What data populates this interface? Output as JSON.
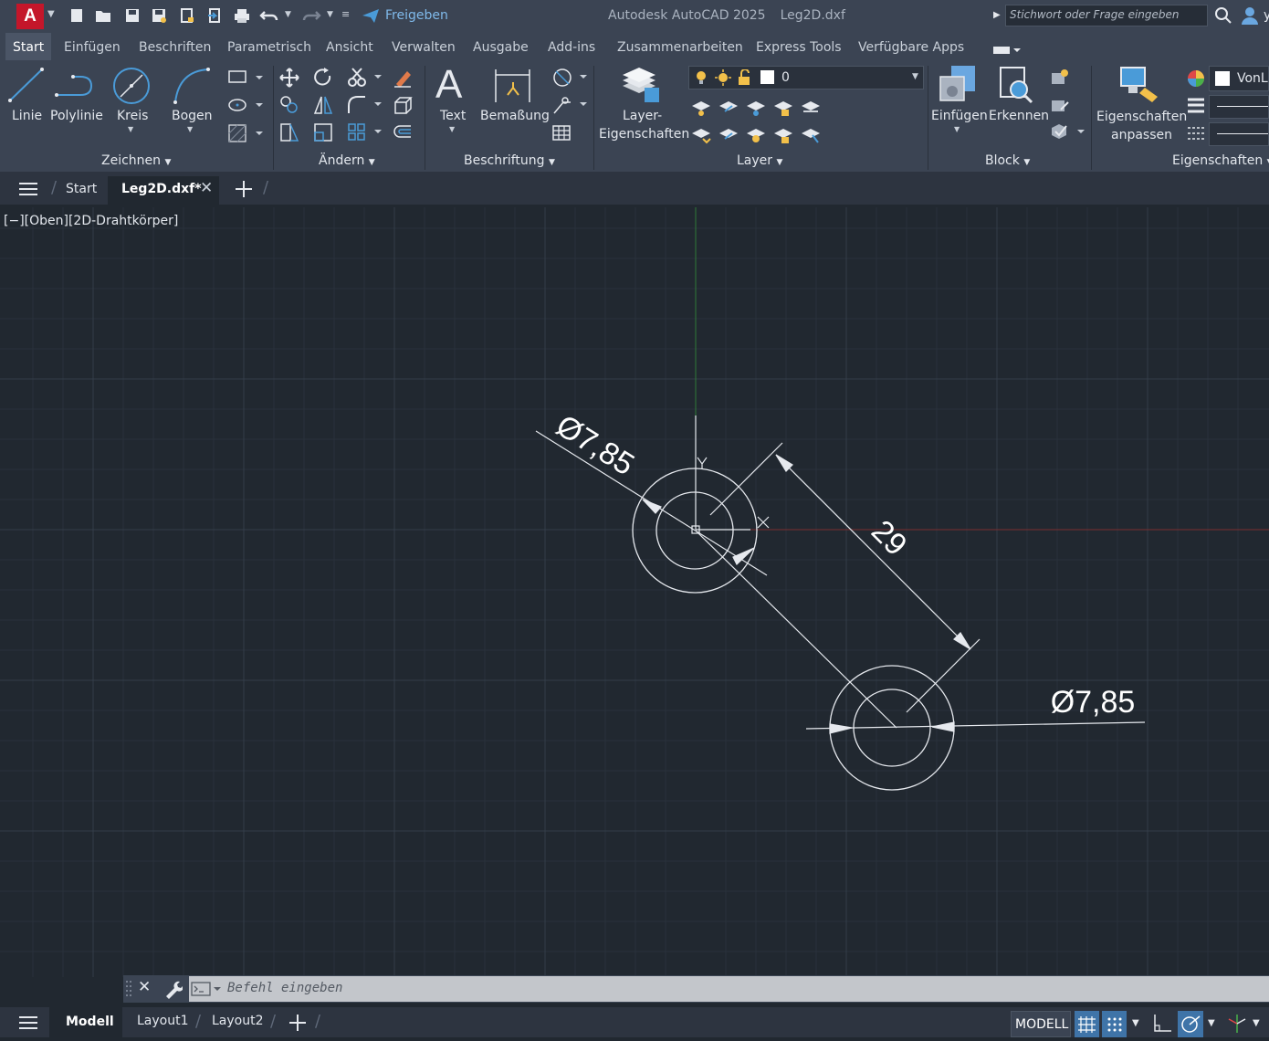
{
  "title_bar": {
    "app_logo": "A",
    "share_label": "Freigeben",
    "app_title": "Autodesk AutoCAD 2025",
    "file_title": "Leg2D.dxf",
    "search_placeholder": "Stichwort oder Frage eingeben",
    "user_initial": "y"
  },
  "ribbon_tabs": [
    "Start",
    "Einfügen",
    "Beschriften",
    "Parametrisch",
    "Ansicht",
    "Verwalten",
    "Ausgabe",
    "Add-ins",
    "Zusammenarbeiten",
    "Express Tools",
    "Verfügbare Apps"
  ],
  "ribbon": {
    "draw": {
      "line": "Linie",
      "polyline": "Polylinie",
      "circle": "Kreis",
      "arc": "Bogen",
      "panel": "Zeichnen"
    },
    "modify": {
      "panel": "Ändern"
    },
    "annotation": {
      "text": "Text",
      "dimension": "Bemaßung",
      "panel": "Beschriftung"
    },
    "layers": {
      "layer_props_1": "Layer-",
      "layer_props_2": "Eigenschaften",
      "current_layer": "0",
      "panel": "Layer"
    },
    "block": {
      "insert": "Einfügen",
      "detect": "Erkennen",
      "panel": "Block"
    },
    "properties": {
      "match_1": "Eigenschaften",
      "match_2": "anpassen",
      "color_value": "VonL",
      "panel": "Eigenschaften"
    }
  },
  "doc_tabs": {
    "start": "Start",
    "active": "Leg2D.dxf*"
  },
  "viewport_label": "[−][Oben][2D-Drahtkörper]",
  "drawing": {
    "dim_top_left": "Ø7,85",
    "dim_linear": "29",
    "dim_right": "Ø7,85",
    "ucs_y": "Y",
    "ucs_x": "X"
  },
  "command_line": {
    "placeholder": "Befehl eingeben"
  },
  "status": {
    "model_tab": "Modell",
    "layout1": "Layout1",
    "layout2": "Layout2",
    "model_button": "MODELL"
  },
  "colors": {
    "background": "#212830",
    "ribbon": "#3b4453",
    "accent": "#4a9bd8",
    "logo": "#c4162a"
  }
}
